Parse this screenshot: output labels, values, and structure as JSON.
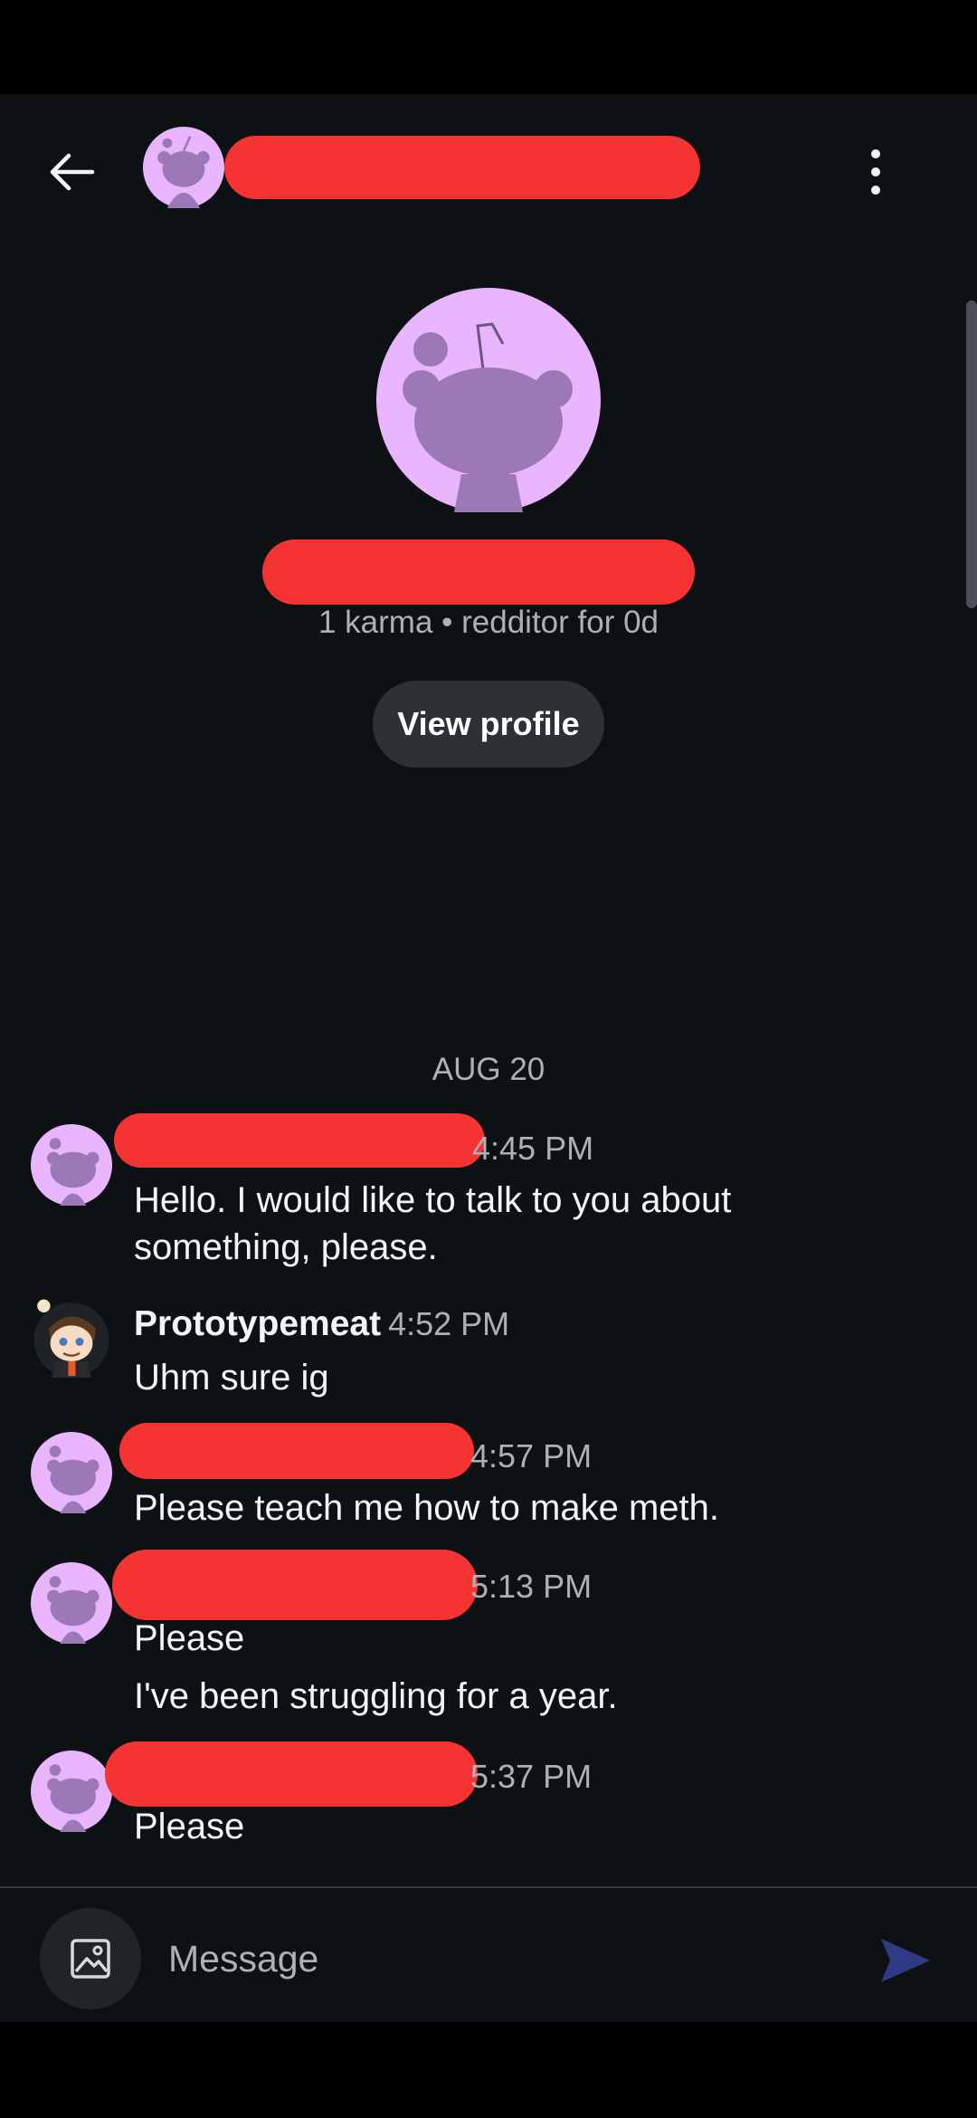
{
  "profile": {
    "karma_line": "1 karma • redditor for 0d",
    "view_profile_label": "View profile"
  },
  "chat": {
    "date_separator": "AUG 20",
    "messages": [
      {
        "author": "",
        "time": "4:45 PM",
        "text": "Hello. I would like to talk to you about something, please."
      },
      {
        "author": "Prototypemeat",
        "time": "4:52 PM",
        "text": "Uhm sure ig"
      },
      {
        "author": "",
        "time": "4:57 PM",
        "text": "Please teach me how to make meth."
      },
      {
        "author": "",
        "time": "5:13 PM",
        "text": "Please",
        "text2": "I've been struggling for a year."
      },
      {
        "author": "",
        "time": "5:37 PM",
        "text": "Please"
      }
    ]
  },
  "composer": {
    "placeholder": "Message"
  },
  "colors": {
    "background": "#0e1114",
    "avatar_bg": "#e9b5fc",
    "avatar_fg": "#9c79b6",
    "redaction": "#f63333",
    "send_icon": "#2f3a86"
  },
  "icons": {
    "back": "arrow-left-icon",
    "more": "vertical-dots-icon",
    "image": "image-icon",
    "send": "send-icon"
  }
}
